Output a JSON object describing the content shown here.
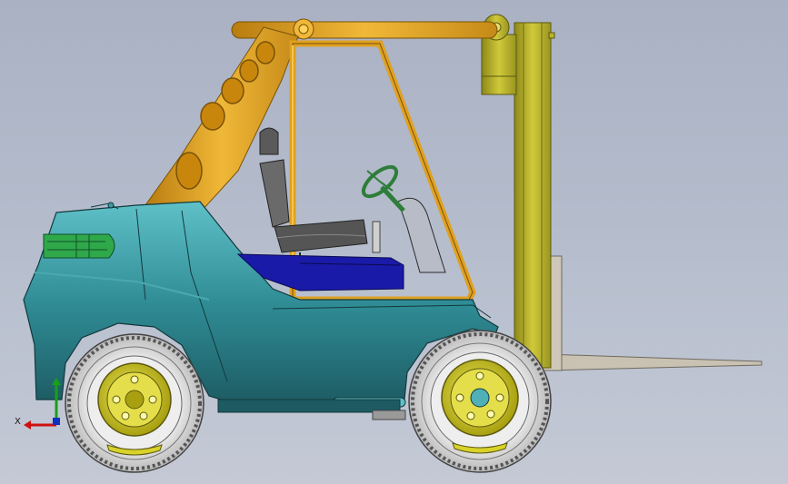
{
  "view": {
    "background_top": "#a9b1c3",
    "background_bottom": "#c4c9d5"
  },
  "model": {
    "subject": "forklift",
    "colors": {
      "body": "#2f8c95",
      "body_dark": "#1f5f66",
      "overhead_guard": "#e0a020",
      "mast": "#b9b42a",
      "forks": "#c9c1b2",
      "seat": "#6a6a6a",
      "floor_panel": "#1a1aa8",
      "steering_wheel": "#2f7d3a",
      "grille": "#2fa84a",
      "tire": "#e6e6e6",
      "rim": "#d8d22a"
    }
  },
  "triad": {
    "x_label": "X",
    "x_color": "#d01010",
    "y_color": "#18a018",
    "z_color": "#1030c0"
  }
}
